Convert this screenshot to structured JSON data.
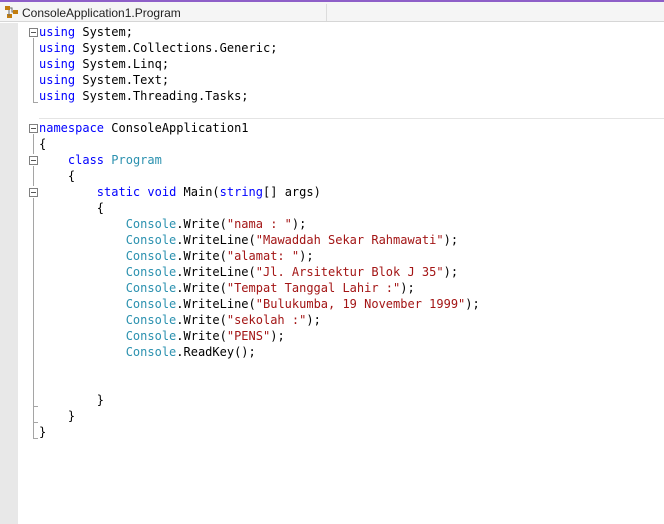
{
  "navbar": {
    "title": "ConsoleApplication1.Program",
    "icon": "class-icon"
  },
  "colors": {
    "keyword": "#0000ff",
    "type": "#2b91af",
    "string": "#a31515"
  },
  "code_lines": [
    [
      {
        "t": "using",
        "c": "kw"
      },
      {
        "t": " System;"
      }
    ],
    [
      {
        "t": "using",
        "c": "kw"
      },
      {
        "t": " System.Collections.Generic;"
      }
    ],
    [
      {
        "t": "using",
        "c": "kw"
      },
      {
        "t": " System.Linq;"
      }
    ],
    [
      {
        "t": "using",
        "c": "kw"
      },
      {
        "t": " System.Text;"
      }
    ],
    [
      {
        "t": "using",
        "c": "kw"
      },
      {
        "t": " System.Threading.Tasks;"
      }
    ],
    [],
    [
      {
        "t": "namespace",
        "c": "kw"
      },
      {
        "t": " ConsoleApplication1"
      }
    ],
    [
      {
        "t": "{"
      }
    ],
    [
      {
        "t": "    "
      },
      {
        "t": "class",
        "c": "kw"
      },
      {
        "t": " "
      },
      {
        "t": "Program",
        "c": "ty"
      }
    ],
    [
      {
        "t": "    {"
      }
    ],
    [
      {
        "t": "        "
      },
      {
        "t": "static",
        "c": "kw"
      },
      {
        "t": " "
      },
      {
        "t": "void",
        "c": "kw"
      },
      {
        "t": " Main("
      },
      {
        "t": "string",
        "c": "kw"
      },
      {
        "t": "[] args)"
      }
    ],
    [
      {
        "t": "        {"
      }
    ],
    [
      {
        "t": "            "
      },
      {
        "t": "Console",
        "c": "ty"
      },
      {
        "t": ".Write("
      },
      {
        "t": "\"nama : \"",
        "c": "st"
      },
      {
        "t": ");"
      }
    ],
    [
      {
        "t": "            "
      },
      {
        "t": "Console",
        "c": "ty"
      },
      {
        "t": ".WriteLine("
      },
      {
        "t": "\"Mawaddah Sekar Rahmawati\"",
        "c": "st"
      },
      {
        "t": ");"
      }
    ],
    [
      {
        "t": "            "
      },
      {
        "t": "Console",
        "c": "ty"
      },
      {
        "t": ".Write("
      },
      {
        "t": "\"alamat: \"",
        "c": "st"
      },
      {
        "t": ");"
      }
    ],
    [
      {
        "t": "            "
      },
      {
        "t": "Console",
        "c": "ty"
      },
      {
        "t": ".WriteLine("
      },
      {
        "t": "\"Jl. Arsitektur Blok J 35\"",
        "c": "st"
      },
      {
        "t": ");"
      }
    ],
    [
      {
        "t": "            "
      },
      {
        "t": "Console",
        "c": "ty"
      },
      {
        "t": ".Write("
      },
      {
        "t": "\"Tempat Tanggal Lahir :\"",
        "c": "st"
      },
      {
        "t": ");"
      }
    ],
    [
      {
        "t": "            "
      },
      {
        "t": "Console",
        "c": "ty"
      },
      {
        "t": ".WriteLine("
      },
      {
        "t": "\"Bulukumba, 19 November 1999\"",
        "c": "st"
      },
      {
        "t": ");"
      }
    ],
    [
      {
        "t": "            "
      },
      {
        "t": "Console",
        "c": "ty"
      },
      {
        "t": ".Write("
      },
      {
        "t": "\"sekolah :\"",
        "c": "st"
      },
      {
        "t": ");"
      }
    ],
    [
      {
        "t": "            "
      },
      {
        "t": "Console",
        "c": "ty"
      },
      {
        "t": ".Write("
      },
      {
        "t": "\"PENS\"",
        "c": "st"
      },
      {
        "t": ");"
      }
    ],
    [
      {
        "t": "            "
      },
      {
        "t": "Console",
        "c": "ty"
      },
      {
        "t": ".ReadKey();"
      }
    ],
    [],
    [],
    [
      {
        "t": "        }"
      }
    ],
    [
      {
        "t": "    }"
      }
    ],
    [
      {
        "t": "}"
      }
    ]
  ]
}
